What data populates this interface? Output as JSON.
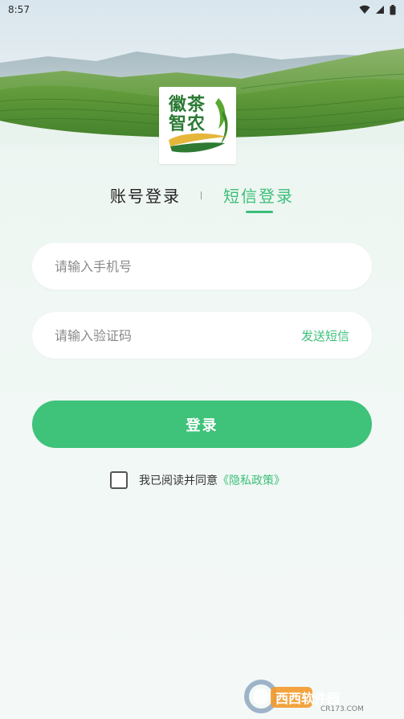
{
  "status_bar": {
    "time": "8:57"
  },
  "logo": {
    "line1": "徽茶",
    "line2": "智农"
  },
  "tabs": [
    {
      "label": "账号登录",
      "active": false
    },
    {
      "label": "短信登录",
      "active": true
    }
  ],
  "form": {
    "phone_placeholder": "请输入手机号",
    "code_placeholder": "请输入验证码",
    "send_sms_label": "发送短信",
    "login_label": "登录"
  },
  "agreement": {
    "checked": false,
    "text": "我已阅读并同意",
    "link": "《隐私政策》"
  },
  "watermark": {
    "brand": "西西软件园",
    "site": "CR173.COM"
  },
  "colors": {
    "accent": "#3bbf78",
    "button": "#3fc27a"
  }
}
